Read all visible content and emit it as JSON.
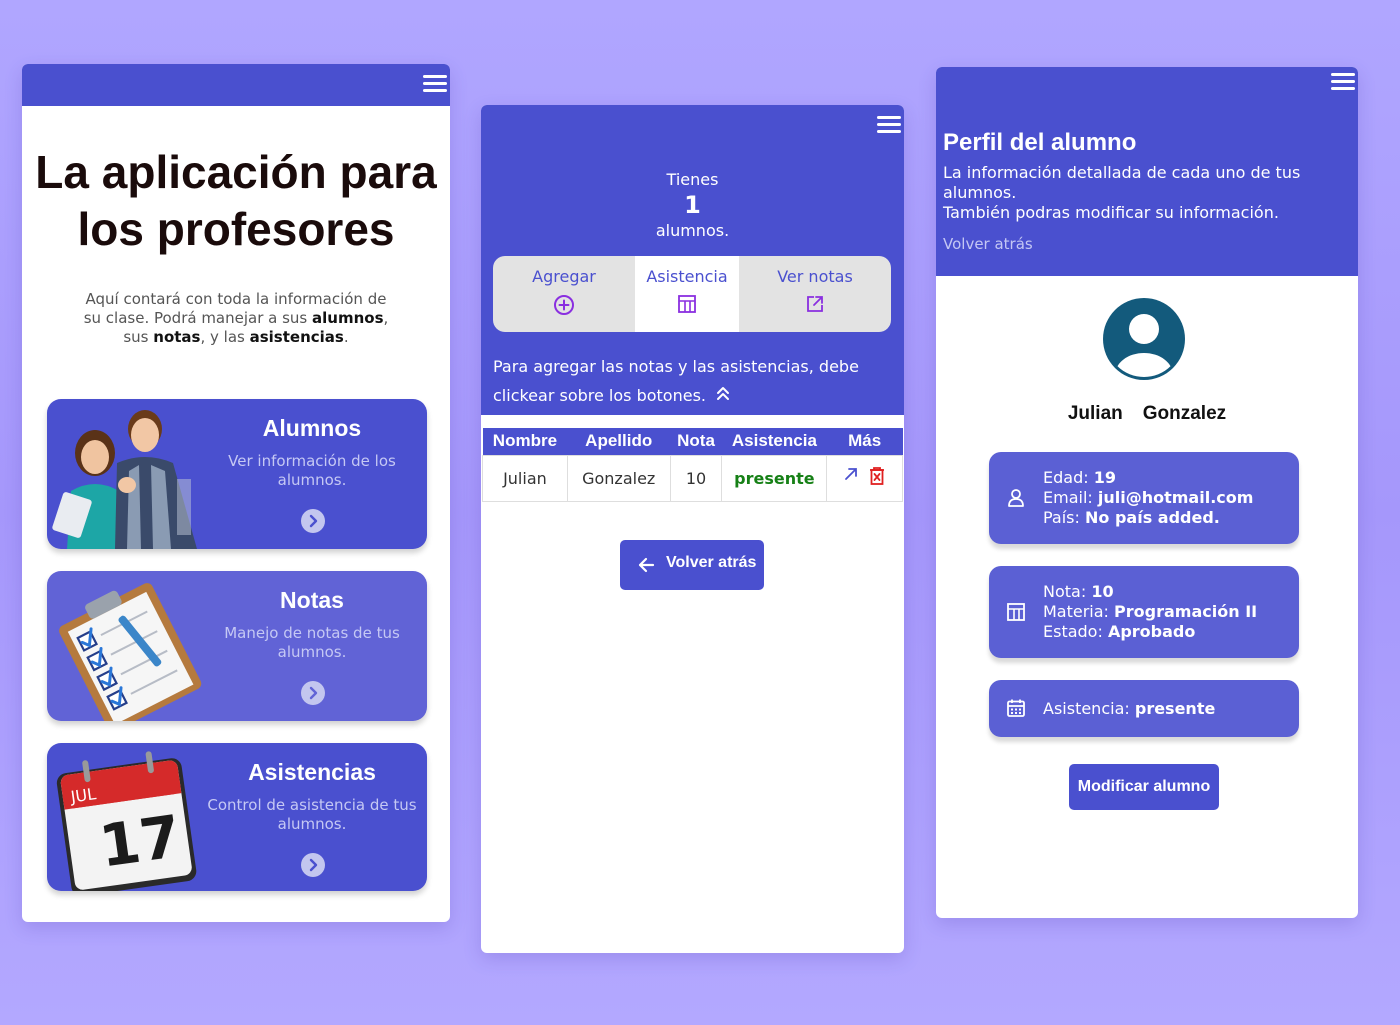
{
  "colors": {
    "primary": "#4a50cf",
    "present": "#168016",
    "avatar": "#135a7c"
  },
  "home": {
    "title": "La aplicación para los profesores",
    "subtitle_parts": [
      "Aquí contará con toda la información de su clase. Podrá manejar a sus ",
      "alumnos",
      ", sus ",
      "notas",
      ", y las ",
      "asistencias",
      "."
    ],
    "cards": [
      {
        "title": "Alumnos",
        "desc": "Ver información de los alumnos.",
        "icon": "students-photo-icon"
      },
      {
        "title": "Notas",
        "desc": "Manejo de notas de tus alumnos.",
        "icon": "clipboard-checklist-icon"
      },
      {
        "title": "Asistencias",
        "desc": "Control de asistencia de tus alumnos.",
        "icon": "calendar-icon"
      }
    ],
    "calendar_month": "JUL",
    "calendar_day": "17"
  },
  "list": {
    "tienes": "Tienes",
    "count": "1",
    "alumnos": "alumnos.",
    "tabs": [
      {
        "label": "Agregar",
        "icon": "plus-circle-icon"
      },
      {
        "label": "Asistencia",
        "icon": "table-icon",
        "active": true
      },
      {
        "label": "Ver notas",
        "icon": "external-link-icon"
      }
    ],
    "hint": "Para agregar las notas y las asistencias, debe clickear sobre los botones.",
    "table": {
      "headers": [
        "Nombre",
        "Apellido",
        "Nota",
        "Asistencia",
        "Más"
      ],
      "rows": [
        {
          "nombre": "Julian",
          "apellido": "Gonzalez",
          "nota": "10",
          "asistencia": "presente"
        }
      ]
    },
    "back_label": "Volver atrás"
  },
  "profile": {
    "title": "Perfil del alumno",
    "desc1": "La información detallada de cada uno de tus alumnos.",
    "desc2": "También podras modificar su información.",
    "back": "Volver atrás",
    "first_name": "Julian",
    "last_name": "Gonzalez",
    "personal": {
      "edad_label": "Edad:",
      "edad": "19",
      "email_label": "Email:",
      "email": "juli@hotmail.com",
      "pais_label": "País:",
      "pais": "No país added."
    },
    "academic": {
      "nota_label": "Nota:",
      "nota": "10",
      "materia_label": "Materia:",
      "materia": "Programación II",
      "estado_label": "Estado:",
      "estado": "Aprobado"
    },
    "attendance": {
      "label": "Asistencia:",
      "value": "presente"
    },
    "modify_label": "Modificar alumno"
  }
}
